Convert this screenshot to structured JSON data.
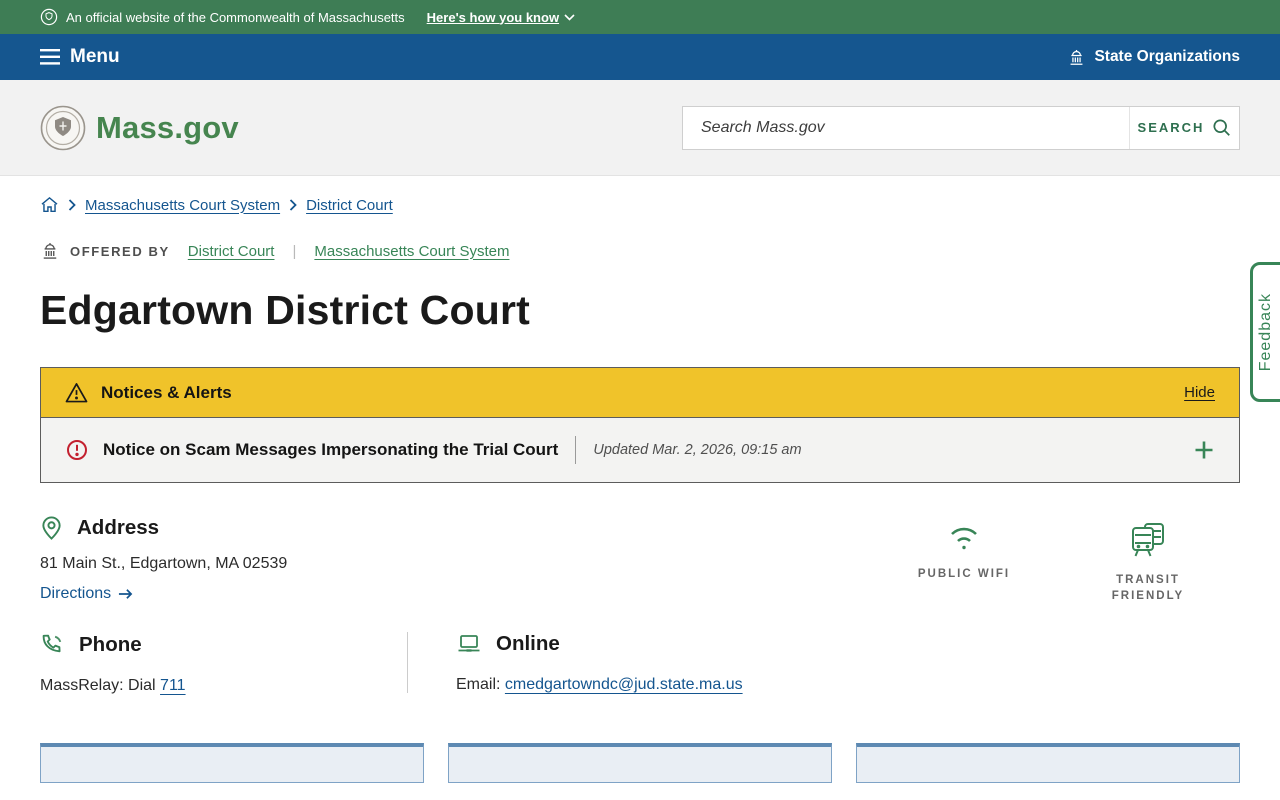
{
  "banner": {
    "official_text": "An official website of the Commonwealth of Massachusetts",
    "how_you_know_label": "Here's how you know"
  },
  "nav": {
    "menu_label": "Menu",
    "state_orgs_label": "State Organizations"
  },
  "header": {
    "logo_text": "Mass.gov",
    "search_placeholder": "Search Mass.gov",
    "search_button_label": "SEARCH"
  },
  "breadcrumb": {
    "items": [
      {
        "label": "Massachusetts Court System"
      },
      {
        "label": "District Court"
      }
    ]
  },
  "offered_by": {
    "label": "OFFERED BY",
    "links": [
      {
        "label": "District Court"
      },
      {
        "label": "Massachusetts Court System"
      }
    ]
  },
  "page": {
    "title": "Edgartown District Court"
  },
  "alerts": {
    "header_label": "Notices & Alerts",
    "hide_label": "Hide",
    "notice": {
      "title": "Notice on Scam Messages Impersonating the Trial Court",
      "updated": "Updated Mar. 2, 2026, 09:15 am"
    }
  },
  "contact": {
    "address": {
      "heading": "Address",
      "line1": "81 Main St., Edgartown, MA 02539",
      "directions_label": "Directions"
    },
    "badges": {
      "wifi": {
        "label": "PUBLIC WIFI"
      },
      "transit": {
        "label": "TRANSIT FRIENDLY"
      }
    },
    "phone": {
      "heading": "Phone",
      "text_prefix": "MassRelay: Dial",
      "relay_number": "711"
    },
    "online": {
      "heading": "Online",
      "email_label": "Email:",
      "email_address": "cmedgartowndc@jud.state.ma.us"
    }
  },
  "feedback": {
    "label": "Feedback"
  },
  "colors": {
    "banner_green": "#3E7D55",
    "nav_blue": "#15568F",
    "link_blue": "#14558F",
    "link_green": "#388557",
    "logo_green": "#46854F",
    "alert_yellow": "#F0C32A",
    "alert_red": "#C3202F"
  }
}
